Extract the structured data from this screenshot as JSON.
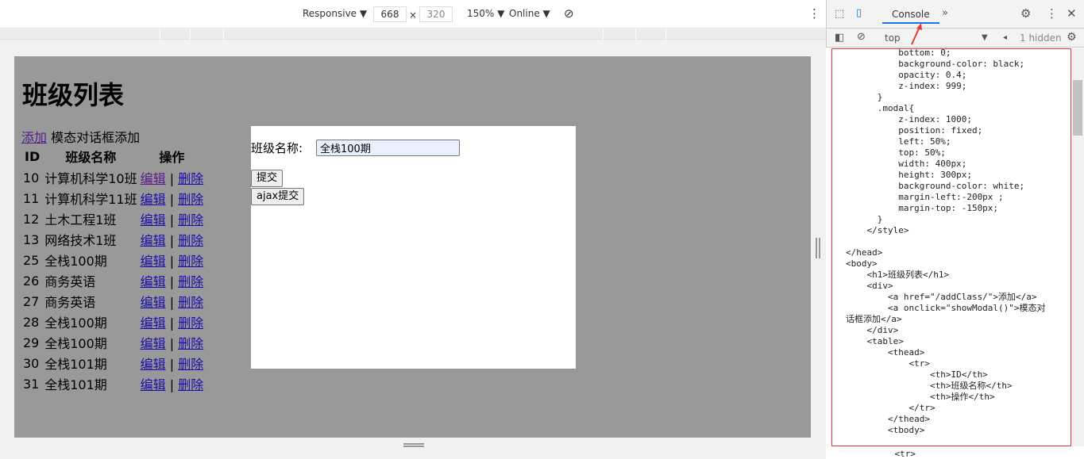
{
  "devtools_toolbar": {
    "device": "Responsive",
    "width": "668",
    "times": "×",
    "height": "320",
    "zoom": "150%",
    "network": "Online"
  },
  "page": {
    "title": "班级列表",
    "add_link": "添加",
    "modal_add_link": "模态对话框添加",
    "headers": [
      "ID",
      "班级名称",
      "操作"
    ],
    "rows": [
      {
        "id": "10",
        "name": "计算机科学10班",
        "edit": "编辑",
        "sep": "|",
        "delete": "删除"
      },
      {
        "id": "11",
        "name": "计算机科学11班",
        "edit": "编辑",
        "sep": "|",
        "delete": "删除"
      },
      {
        "id": "12",
        "name": "土木工程1班",
        "edit": "编辑",
        "sep": "|",
        "delete": "删除"
      },
      {
        "id": "13",
        "name": "网络技术1班",
        "edit": "编辑",
        "sep": "|",
        "delete": "删除"
      },
      {
        "id": "25",
        "name": "全栈100期",
        "edit": "编辑",
        "sep": "|",
        "delete": "删除"
      },
      {
        "id": "26",
        "name": "商务英语",
        "edit": "编辑",
        "sep": "|",
        "delete": "删除"
      },
      {
        "id": "27",
        "name": "商务英语",
        "edit": "编辑",
        "sep": "|",
        "delete": "删除"
      },
      {
        "id": "28",
        "name": "全栈100期",
        "edit": "编辑",
        "sep": "|",
        "delete": "删除"
      },
      {
        "id": "29",
        "name": "全栈100期",
        "edit": "编辑",
        "sep": "|",
        "delete": "删除"
      },
      {
        "id": "30",
        "name": "全栈101期",
        "edit": "编辑",
        "sep": "|",
        "delete": "删除"
      },
      {
        "id": "31",
        "name": "全栈101期",
        "edit": "编辑",
        "sep": "|",
        "delete": "删除"
      }
    ],
    "modal": {
      "label": "班级名称:",
      "input_value": "全栈100期",
      "submit": "提交",
      "ajax_submit": "ajax提交"
    }
  },
  "devtools_panel": {
    "tab_console": "Console",
    "more_tabs": "»",
    "context": "top",
    "hidden": "1 hidden",
    "code_lines": [
      "          bottom: 0;",
      "          background-color: black;",
      "          opacity: 0.4;",
      "          z-index: 999;",
      "      }",
      "      .modal{",
      "          z-index: 1000;",
      "          position: fixed;",
      "          left: 50%;",
      "          top: 50%;",
      "          width: 400px;",
      "          height: 300px;",
      "          background-color: white;",
      "          margin-left:-200px ;",
      "          margin-top: -150px;",
      "      }",
      "    </style>",
      "",
      "</head>",
      "<body>",
      "    <h1>班级列表</h1>",
      "    <div>",
      "        <a href=\"/addClass/\">添加</a>",
      "        <a onclick=\"showModal()\">模态对",
      "话框添加</a>",
      "    </div>",
      "    <table>",
      "        <thead>",
      "            <tr>",
      "                <th>ID</th>",
      "                <th>班级名称</th>",
      "                <th>操作</th>",
      "            </tr>",
      "        </thead>",
      "        <tbody>"
    ],
    "bottom_line": "            <tr>"
  }
}
